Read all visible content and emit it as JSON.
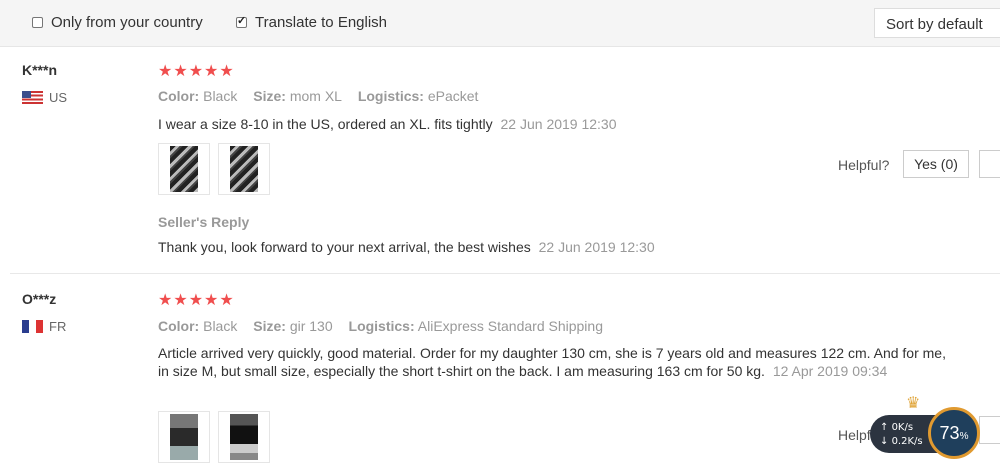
{
  "filters": {
    "only_country": "Only from your country",
    "translate": "Translate to English",
    "sort": "Sort by default"
  },
  "reviews": [
    {
      "user": "K***n",
      "country": "US",
      "stars": "★★★★★",
      "color_label": "Color:",
      "color": "Black",
      "size_label": "Size:",
      "size": "mom XL",
      "logistics_label": "Logistics:",
      "logistics": "ePacket",
      "text": "I wear a size 8-10 in the US, ordered an XL. fits tightly",
      "date": "22 Jun 2019 12:30",
      "seller_reply_label": "Seller's Reply",
      "seller_reply": "Thank you, look forward to your next arrival, the best wishes",
      "seller_reply_date": "22 Jun 2019 12:30",
      "helpful_label": "Helpful?",
      "yes_label": "Yes (0)"
    },
    {
      "user": "O***z",
      "country": "FR",
      "stars": "★★★★★",
      "color_label": "Color:",
      "color": "Black",
      "size_label": "Size:",
      "size": "gir 130",
      "logistics_label": "Logistics:",
      "logistics": "AliExpress Standard Shipping",
      "text": "Article arrived very quickly, good material. Order for my daughter 130 cm, she is 7 years old and measures 122 cm. And for me, in size M, but small size, especially the short t-shirt on the back. I am measuring 163 cm for 50 kg.",
      "date": "12 Apr 2019 09:34",
      "helpful_label": "Helpful?"
    }
  ],
  "speed_widget": {
    "up": "0K/s",
    "down": "0.2K/s",
    "percent": "73",
    "percent_sign": "%"
  }
}
